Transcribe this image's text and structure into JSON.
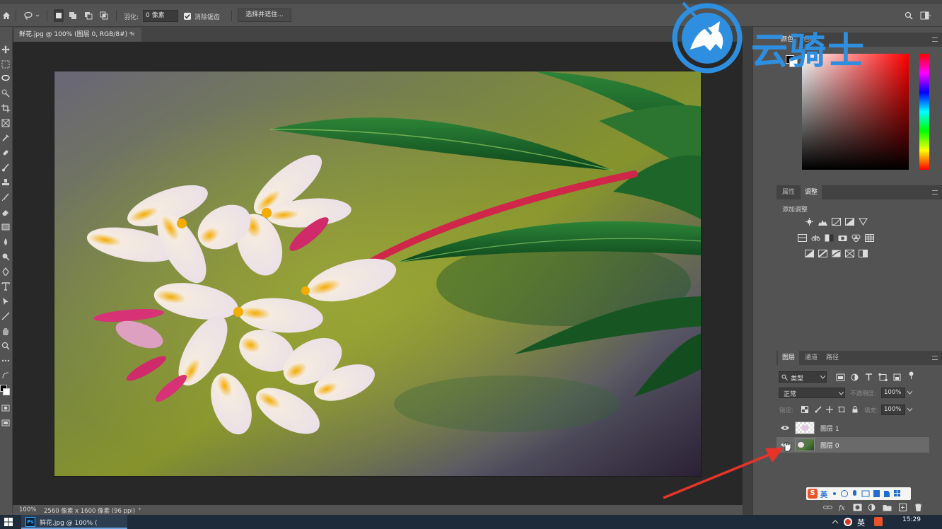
{
  "options_bar": {
    "feather_label": "羽化:",
    "feather_value": "0 像素",
    "antialias_label": "消除锯齿",
    "select_mask_button": "选择并遮住..."
  },
  "document": {
    "tab_title": "鲜花.jpg @ 100% (图层 0, RGB/8#) *",
    "close_symbol": "×"
  },
  "status": {
    "zoom": "100%",
    "info": "2560 像素 x 1600 像素 (96 ppi)",
    "arrow": "›"
  },
  "color_panel": {
    "tabs": [
      "颜色",
      "色板"
    ],
    "hue_accent": "#ff0000"
  },
  "properties_panel": {
    "tabs": [
      "属性",
      "调整"
    ],
    "heading": "添加调整"
  },
  "layers_panel": {
    "tabs": [
      "图层",
      "通道",
      "路径"
    ],
    "filter_kind": "类型",
    "blend_mode": "正常",
    "opacity_label": "不透明度:",
    "opacity_value": "100%",
    "lock_label": "锁定:",
    "fill_label": "填充:",
    "fill_value": "100%",
    "layers": [
      {
        "name": "图层 1",
        "visible": true,
        "selected": false
      },
      {
        "name": "图层 0",
        "visible": true,
        "selected": true
      }
    ]
  },
  "taskbar": {
    "app_label": "鲜花.jpg @ 100% (",
    "ime_lang": "英",
    "time": "15:29"
  },
  "ime_toolbar": {
    "lang": "英"
  },
  "watermark": {
    "text": "云骑士"
  },
  "colors": {
    "accent_blue": "#2e8fe0",
    "annotation_arrow": "#e8332a"
  }
}
